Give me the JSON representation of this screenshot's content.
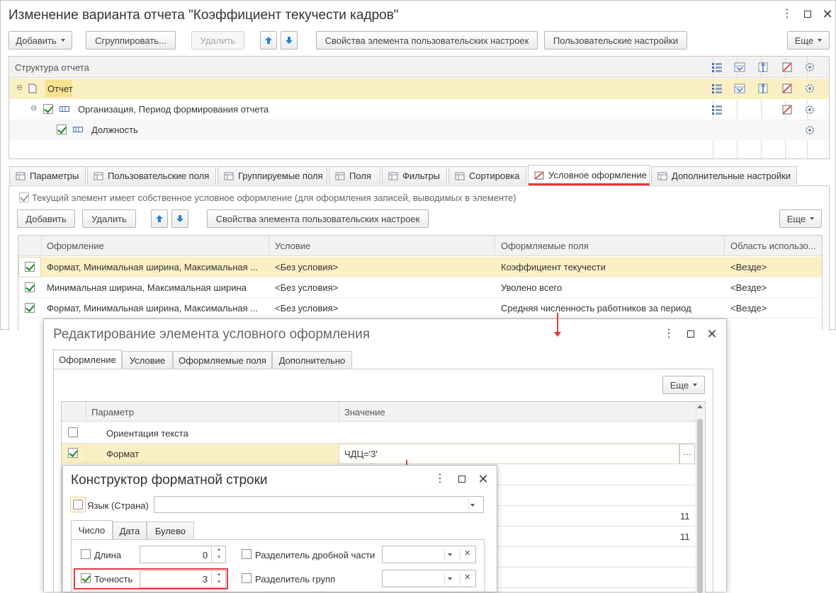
{
  "main": {
    "title": "Изменение варианта отчета \"Коэффициент текучести кадров\"",
    "toolbar": {
      "add": "Добавить",
      "group": "Сгруппировать...",
      "delete": "Удалить",
      "user_element_props": "Свойства элемента пользовательских настроек",
      "user_settings": "Пользовательские настройки",
      "more": "Еще"
    },
    "structure_header": "Структура отчета",
    "tree": [
      {
        "label": "Отчет"
      },
      {
        "label": "Организация, Период формирования отчета"
      },
      {
        "label": "Должность"
      }
    ],
    "tabs": [
      "Параметры",
      "Пользовательские поля",
      "Группируемые поля",
      "Поля",
      "Фильтры",
      "Сортировка",
      "Условное оформление",
      "Дополнительные настройки"
    ],
    "own_format_checkbox": "Текущий элемент имеет собственное условное оформление (для оформления записей, выводимых в элементе)",
    "cf_toolbar": {
      "add": "Добавить",
      "delete": "Удалить",
      "user_element_props": "Свойства элемента пользовательских настроек",
      "more": "Еще"
    },
    "table": {
      "columns": [
        "Оформление",
        "Условие",
        "Оформляемые поля",
        "Область использо..."
      ],
      "rows": [
        [
          "Формат, Минимальная ширина, Максимальная ...",
          "<Без условия>",
          "Коэффициент текучести",
          "<Везде>"
        ],
        [
          "Минимальная ширина, Максимальная ширина",
          "<Без условия>",
          "Уволено всего",
          "<Везде>"
        ],
        [
          "Формат, Минимальная ширина, Максимальная ...",
          "<Без условия>",
          "Средняя численность работников за период",
          "<Везде>"
        ]
      ]
    }
  },
  "edit_dialog": {
    "title": "Редактирование элемента условного оформления",
    "tabs": [
      "Оформление",
      "Условие",
      "Оформляемые поля",
      "Дополнительно"
    ],
    "more": "Еще",
    "columns": [
      "Параметр",
      "Значение"
    ],
    "rows": [
      {
        "param": "Ориентация текста",
        "value": ""
      },
      {
        "param": "Формат",
        "value": "ЧДЦ='3'"
      }
    ],
    "side_values": [
      "11",
      "11"
    ]
  },
  "format_dialog": {
    "title": "Конструктор форматной строки",
    "lang_label": "Язык (Страна)",
    "tabs": [
      "Число",
      "Дата",
      "Булево"
    ],
    "length_label": "Длина",
    "length_value": "0",
    "precision_label": "Точность",
    "precision_value": "3",
    "decimal_sep_label": "Разделитель дробной части",
    "group_sep_label": "Разделитель групп"
  },
  "colors": {
    "selected_row": "#fbf0c4",
    "highlight_red": "#e03c3c",
    "arrow_blue": "#2c7fd6",
    "check_green": "#1c8a1c"
  }
}
